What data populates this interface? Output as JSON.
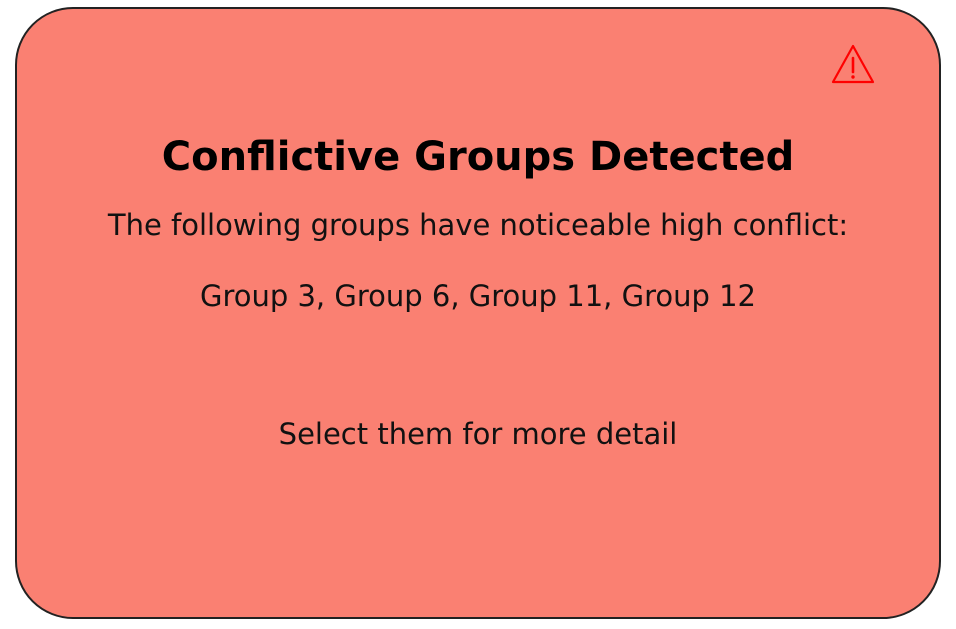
{
  "alert": {
    "icon": "warning-icon",
    "title": "Conflictive Groups Detected",
    "message": "The following groups have noticeable high conflict:",
    "groups": "Group 3, Group 6, Group 11, Group 12",
    "hint": "Select them for more detail"
  },
  "colors": {
    "card_background": "#fa8072",
    "card_border": "#222222",
    "icon": "#ff0000",
    "text": "#000000"
  }
}
